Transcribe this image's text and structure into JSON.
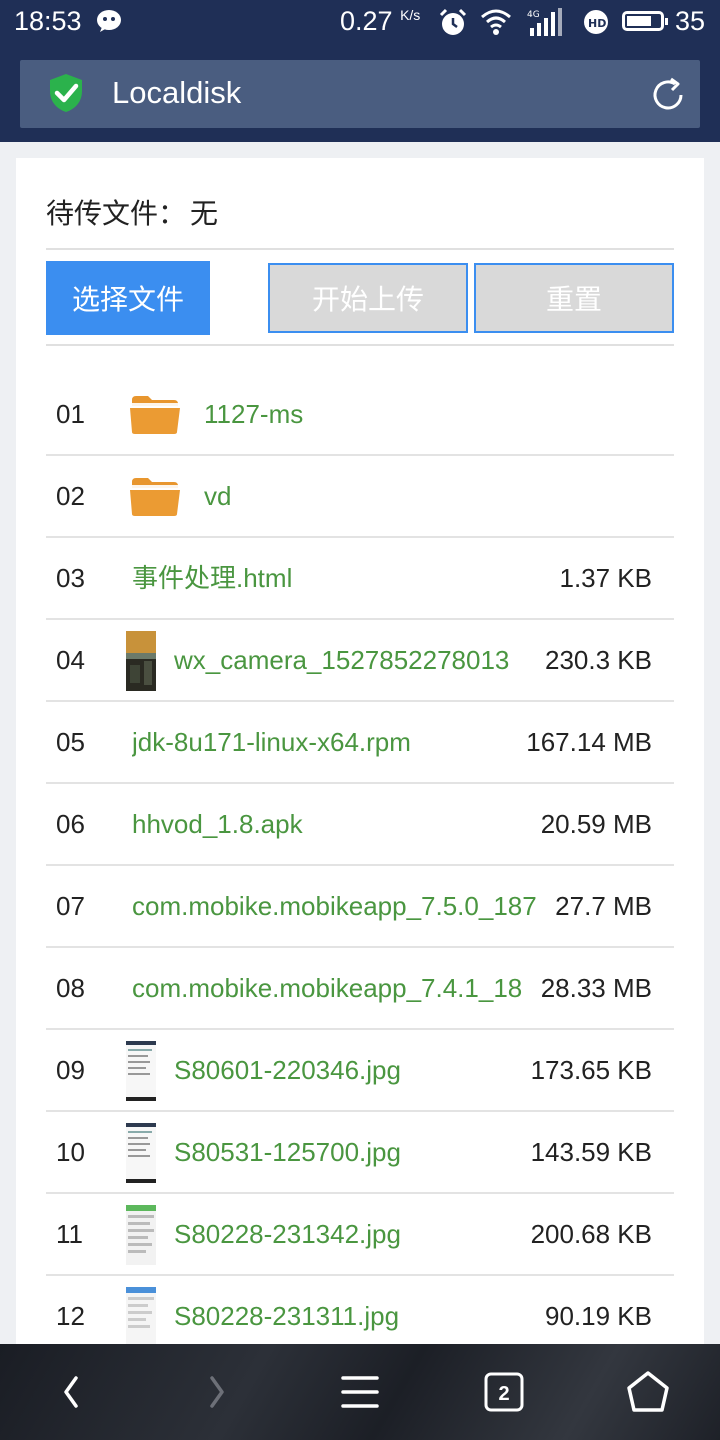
{
  "status_bar": {
    "time": "18:53",
    "net_rate": "0.27",
    "net_unit": "K/s",
    "network": "4G",
    "battery": "35"
  },
  "app_bar": {
    "title": "Localdisk"
  },
  "upload": {
    "pending_label": "待传文件：",
    "pending_value": "无",
    "select_label": "选择文件",
    "start_label": "开始上传",
    "reset_label": "重置"
  },
  "files": [
    {
      "index": "01",
      "name": "1127-ms",
      "size": "",
      "kind": "folder"
    },
    {
      "index": "02",
      "name": "vd",
      "size": "",
      "kind": "folder"
    },
    {
      "index": "03",
      "name": "事件处理.html",
      "size": "1.37 KB",
      "kind": "file"
    },
    {
      "index": "04",
      "name": "wx_camera_1527852278013",
      "size": "230.3 KB",
      "kind": "image-photo"
    },
    {
      "index": "05",
      "name": "jdk-8u171-linux-x64.rpm",
      "size": "167.14 MB",
      "kind": "file"
    },
    {
      "index": "06",
      "name": "hhvod_1.8.apk",
      "size": "20.59 MB",
      "kind": "file"
    },
    {
      "index": "07",
      "name": "com.mobike.mobikeapp_7.5.0_187",
      "size": "27.7 MB",
      "kind": "file"
    },
    {
      "index": "08",
      "name": "com.mobike.mobikeapp_7.4.1_18",
      "size": "28.33 MB",
      "kind": "file"
    },
    {
      "index": "09",
      "name": "S80601-220346.jpg",
      "size": "173.65 KB",
      "kind": "image-screenshot"
    },
    {
      "index": "10",
      "name": "S80531-125700.jpg",
      "size": "143.59 KB",
      "kind": "image-screenshot"
    },
    {
      "index": "11",
      "name": "S80228-231342.jpg",
      "size": "200.68 KB",
      "kind": "image-screenshot-green"
    },
    {
      "index": "12",
      "name": "S80228-231311.jpg",
      "size": "90.19 KB",
      "kind": "image-screenshot-blue"
    }
  ],
  "nav_bar": {
    "tab_count": "2"
  },
  "colors": {
    "accent": "#3b8ef0",
    "filename": "#4a9640",
    "header": "#1f2f56",
    "folder": "#e8962e"
  }
}
